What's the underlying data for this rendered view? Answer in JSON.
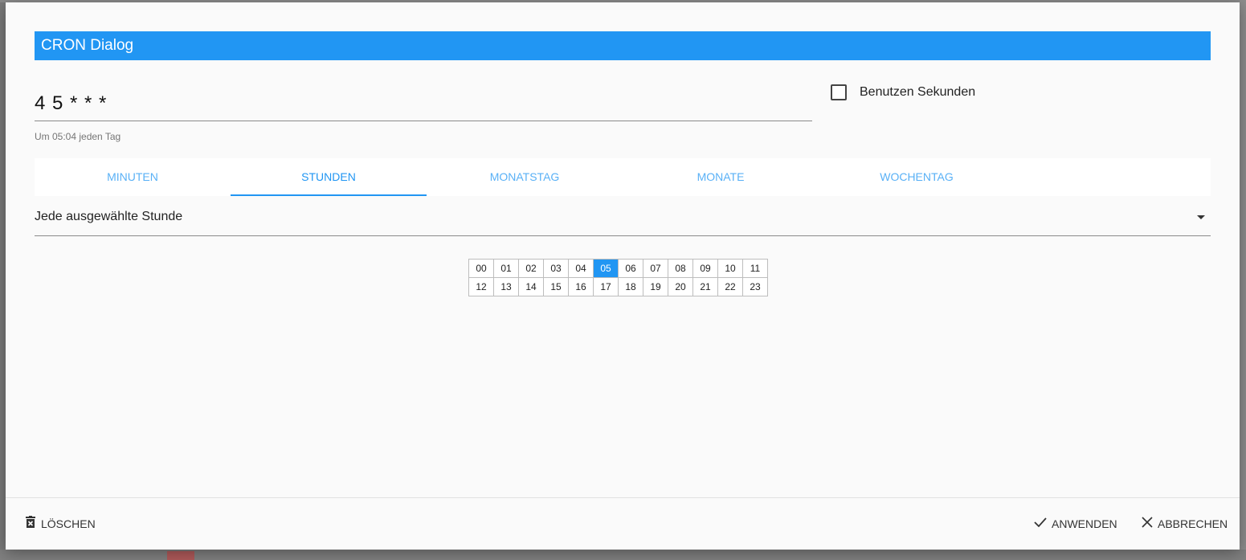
{
  "dialog": {
    "title": "CRON Dialog"
  },
  "cron": {
    "expression": "4 5 * * *",
    "description": "Um 05:04 jeden Tag"
  },
  "seconds_toggle": {
    "label": "Benutzen Sekunden",
    "checked": false
  },
  "tabs": [
    {
      "label": "MINUTEN",
      "active": false
    },
    {
      "label": "STUNDEN",
      "active": true
    },
    {
      "label": "MONATSTAG",
      "active": false
    },
    {
      "label": "MONATE",
      "active": false
    },
    {
      "label": "WOCHENTAG",
      "active": false
    }
  ],
  "mode_select": {
    "value": "Jede ausgewählte Stunde"
  },
  "hours": {
    "row1": [
      "00",
      "01",
      "02",
      "03",
      "04",
      "05",
      "06",
      "07",
      "08",
      "09",
      "10",
      "11"
    ],
    "row2": [
      "12",
      "13",
      "14",
      "15",
      "16",
      "17",
      "18",
      "19",
      "20",
      "21",
      "22",
      "23"
    ],
    "selected": [
      "05"
    ]
  },
  "footer": {
    "clear_label": "LÖSCHEN",
    "apply_label": "ANWENDEN",
    "cancel_label": "ABBRECHEN"
  },
  "colors": {
    "accent": "#2196f3",
    "dialog_bg": "#fafafa"
  },
  "icons": {
    "clear": "delete-forever-icon",
    "apply": "check-icon",
    "cancel": "close-icon",
    "select": "caret-down-icon"
  }
}
